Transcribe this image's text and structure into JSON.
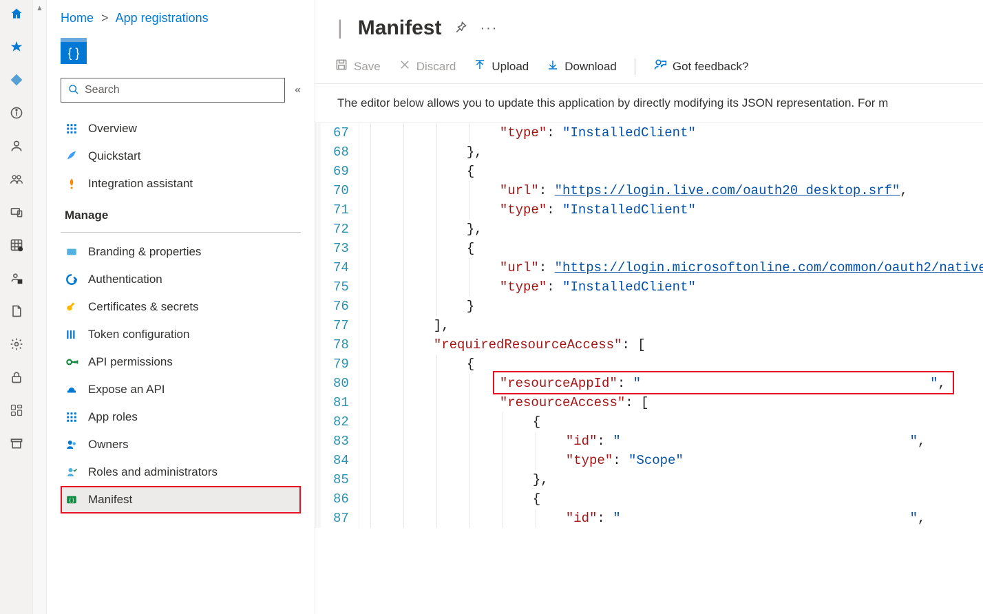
{
  "breadcrumb": {
    "home": "Home",
    "current": "App registrations"
  },
  "search": {
    "placeholder": "Search"
  },
  "nav": {
    "items": [
      {
        "label": "Overview"
      },
      {
        "label": "Quickstart"
      },
      {
        "label": "Integration assistant"
      }
    ],
    "manageHeader": "Manage",
    "manage": [
      {
        "label": "Branding & properties"
      },
      {
        "label": "Authentication"
      },
      {
        "label": "Certificates & secrets"
      },
      {
        "label": "Token configuration"
      },
      {
        "label": "API permissions"
      },
      {
        "label": "Expose an API"
      },
      {
        "label": "App roles"
      },
      {
        "label": "Owners"
      },
      {
        "label": "Roles and administrators"
      },
      {
        "label": "Manifest"
      }
    ]
  },
  "page": {
    "titlePrefix": "|",
    "title": "Manifest"
  },
  "toolbar": {
    "save": "Save",
    "discard": "Discard",
    "upload": "Upload",
    "download": "Download",
    "feedback": "Got feedback?"
  },
  "description": "The editor below allows you to update this application by directly modifying its JSON representation. For m",
  "editor": {
    "startLine": 67,
    "lines": [
      {
        "indent": 4,
        "segs": [
          {
            "t": "key",
            "v": "\"type\""
          },
          {
            "t": "p",
            "v": ": "
          },
          {
            "t": "str",
            "v": "\"InstalledClient\""
          }
        ]
      },
      {
        "indent": 3,
        "segs": [
          {
            "t": "p",
            "v": "},"
          }
        ]
      },
      {
        "indent": 3,
        "segs": [
          {
            "t": "p",
            "v": "{"
          }
        ]
      },
      {
        "indent": 4,
        "segs": [
          {
            "t": "key",
            "v": "\"url\""
          },
          {
            "t": "p",
            "v": ": "
          },
          {
            "t": "url",
            "v": "\"https://login.live.com/oauth20_desktop.srf\""
          },
          {
            "t": "p",
            "v": ","
          }
        ]
      },
      {
        "indent": 4,
        "segs": [
          {
            "t": "key",
            "v": "\"type\""
          },
          {
            "t": "p",
            "v": ": "
          },
          {
            "t": "str",
            "v": "\"InstalledClient\""
          }
        ]
      },
      {
        "indent": 3,
        "segs": [
          {
            "t": "p",
            "v": "},"
          }
        ]
      },
      {
        "indent": 3,
        "segs": [
          {
            "t": "p",
            "v": "{"
          }
        ]
      },
      {
        "indent": 4,
        "segs": [
          {
            "t": "key",
            "v": "\"url\""
          },
          {
            "t": "p",
            "v": ": "
          },
          {
            "t": "url",
            "v": "\"https://login.microsoftonline.com/common/oauth2/native"
          }
        ]
      },
      {
        "indent": 4,
        "segs": [
          {
            "t": "key",
            "v": "\"type\""
          },
          {
            "t": "p",
            "v": ": "
          },
          {
            "t": "str",
            "v": "\"InstalledClient\""
          }
        ]
      },
      {
        "indent": 3,
        "segs": [
          {
            "t": "p",
            "v": "}"
          }
        ]
      },
      {
        "indent": 2,
        "segs": [
          {
            "t": "p",
            "v": "],"
          }
        ]
      },
      {
        "indent": 2,
        "segs": [
          {
            "t": "key",
            "v": "\"requiredResourceAccess\""
          },
          {
            "t": "p",
            "v": ": ["
          }
        ]
      },
      {
        "indent": 3,
        "segs": [
          {
            "t": "p",
            "v": "{"
          }
        ]
      },
      {
        "indent": 4,
        "segs": [
          {
            "t": "key",
            "v": "\"resourceAppId\""
          },
          {
            "t": "p",
            "v": ": "
          },
          {
            "t": "str",
            "v": "\""
          },
          {
            "t": "gap",
            "v": 420
          },
          {
            "t": "str",
            "v": "\""
          },
          {
            "t": "p",
            "v": ","
          }
        ],
        "hl": true
      },
      {
        "indent": 4,
        "segs": [
          {
            "t": "key",
            "v": "\"resourceAccess\""
          },
          {
            "t": "p",
            "v": ": ["
          }
        ]
      },
      {
        "indent": 5,
        "segs": [
          {
            "t": "p",
            "v": "{"
          }
        ]
      },
      {
        "indent": 6,
        "segs": [
          {
            "t": "key",
            "v": "\"id\""
          },
          {
            "t": "p",
            "v": ": "
          },
          {
            "t": "str",
            "v": "\""
          },
          {
            "t": "gap",
            "v": 420
          },
          {
            "t": "str",
            "v": "\""
          },
          {
            "t": "p",
            "v": ","
          }
        ]
      },
      {
        "indent": 6,
        "segs": [
          {
            "t": "key",
            "v": "\"type\""
          },
          {
            "t": "p",
            "v": ": "
          },
          {
            "t": "str",
            "v": "\"Scope\""
          }
        ]
      },
      {
        "indent": 5,
        "segs": [
          {
            "t": "p",
            "v": "},"
          }
        ]
      },
      {
        "indent": 5,
        "segs": [
          {
            "t": "p",
            "v": "{"
          }
        ]
      },
      {
        "indent": 6,
        "segs": [
          {
            "t": "key",
            "v": "\"id\""
          },
          {
            "t": "p",
            "v": ": "
          },
          {
            "t": "str",
            "v": "\""
          },
          {
            "t": "gap",
            "v": 420
          },
          {
            "t": "str",
            "v": "\""
          },
          {
            "t": "p",
            "v": ","
          }
        ]
      }
    ]
  }
}
